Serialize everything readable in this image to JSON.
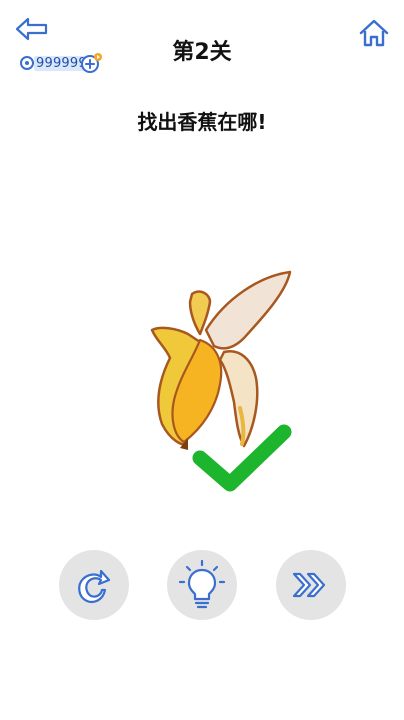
{
  "header": {
    "level_title": "第2关",
    "back_icon": "back-arrow-icon",
    "home_icon": "home-icon"
  },
  "currency": {
    "key_count": "999999",
    "key_icon": "key-icon",
    "add_icon": "plus-icon"
  },
  "puzzle": {
    "prompt": "找出香蕉在哪!",
    "answer_state": "correct",
    "banana_icon": "peeled-banana-icon",
    "check_icon": "check-mark-icon"
  },
  "controls": [
    {
      "icon": "restart-icon"
    },
    {
      "icon": "lightbulb-icon"
    },
    {
      "icon": "skip-icon"
    }
  ],
  "colors": {
    "icon_blue": "#3a6fd0",
    "button_gray": "#e4e4e4",
    "check_green": "#1db52d",
    "banana_yellow": "#f3c93a"
  }
}
